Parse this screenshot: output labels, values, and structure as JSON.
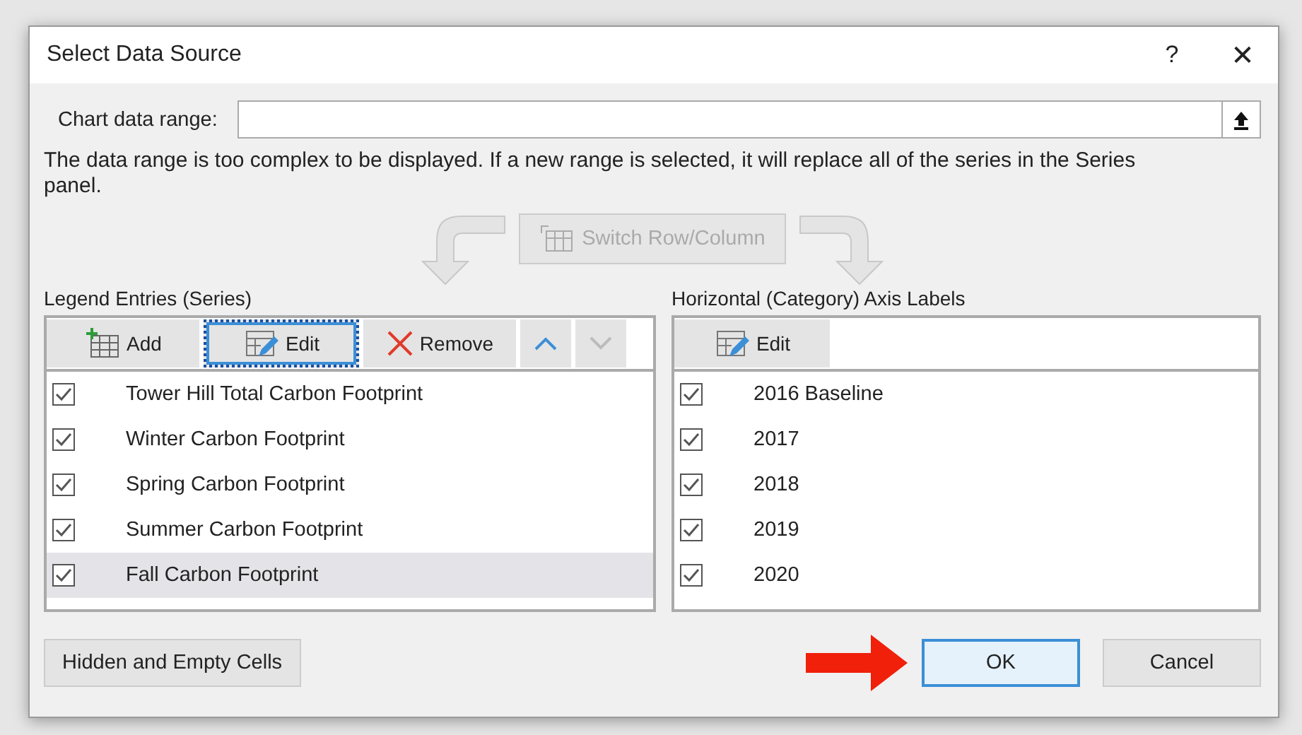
{
  "window": {
    "title": "Select Data Source",
    "help": "?",
    "close": "✕"
  },
  "chart_data_range": {
    "label": "Chart data range:"
  },
  "message": "The data range is too complex to be displayed. If a new range is selected, it will replace all of the series in the Series panel.",
  "switch_button": {
    "label": "Switch Row/Column",
    "disabled": true
  },
  "legend_entries": {
    "title": "Legend Entries (Series)",
    "toolbar": [
      {
        "kind": "add",
        "label": "Add",
        "focused": false,
        "disabled": false
      },
      {
        "kind": "edit",
        "label": "Edit",
        "focused": true,
        "disabled": false
      },
      {
        "kind": "remove",
        "label": "Remove",
        "focused": false,
        "disabled": false
      },
      {
        "kind": "up",
        "focused": false,
        "disabled": false
      },
      {
        "kind": "down",
        "focused": false,
        "disabled": true
      }
    ],
    "items": [
      {
        "label": "Tower Hill Total Carbon Footprint",
        "checked": true,
        "selected": false
      },
      {
        "label": "Winter Carbon Footprint",
        "checked": true,
        "selected": false
      },
      {
        "label": "Spring Carbon Footprint",
        "checked": true,
        "selected": false
      },
      {
        "label": "Summer Carbon Footprint",
        "checked": true,
        "selected": false
      },
      {
        "label": "Fall Carbon Footprint",
        "checked": true,
        "selected": true
      }
    ]
  },
  "axis_labels": {
    "title": "Horizontal (Category) Axis Labels",
    "toolbar": [
      {
        "kind": "edit",
        "label": "Edit",
        "focused": false,
        "disabled": false
      }
    ],
    "items": [
      {
        "label": "2016 Baseline",
        "checked": true,
        "selected": false
      },
      {
        "label": "2017",
        "checked": true,
        "selected": false
      },
      {
        "label": "2018",
        "checked": true,
        "selected": false
      },
      {
        "label": "2019",
        "checked": true,
        "selected": false
      },
      {
        "label": "2020",
        "checked": true,
        "selected": false
      }
    ]
  },
  "buttons": [
    {
      "kind": "secondary",
      "label": "Hidden and Empty Cells",
      "default": false
    },
    {
      "kind": "primary",
      "label": "OK",
      "default": true
    },
    {
      "kind": "primary",
      "label": "Cancel",
      "default": false
    }
  ]
}
